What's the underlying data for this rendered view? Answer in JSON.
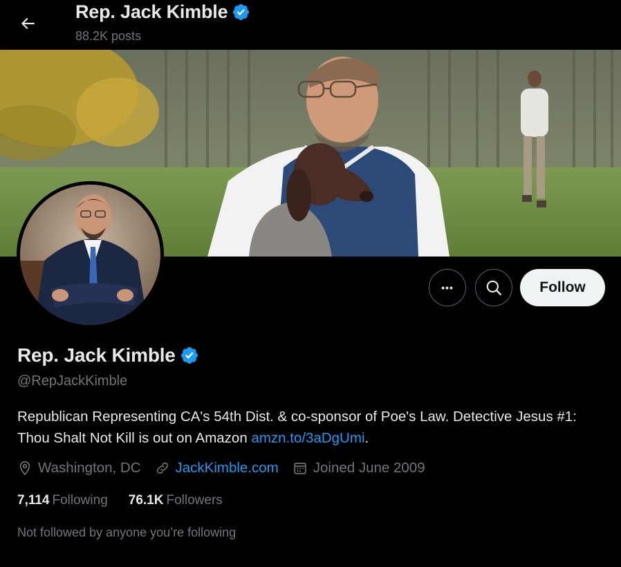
{
  "header": {
    "name": "Rep. Jack Kimble",
    "posts": "88.2K posts"
  },
  "actions": {
    "more_glyph": "•••",
    "follow_label": "Follow"
  },
  "profile": {
    "name": "Rep. Jack Kimble",
    "handle": "@RepJackKimble",
    "bio_text": "Republican Representing CA's 54th Dist. & co-sponsor of Poe's Law. Detective Jesus #1: Thou Shalt Not Kill is out on Amazon ",
    "bio_link": "amzn.to/3aDgUmi",
    "bio_end": ".",
    "location": "Washington, DC",
    "website": "JackKimble.com",
    "joined": "Joined June 2009"
  },
  "stats": {
    "following_count": "7,114",
    "following_label": "Following",
    "followers_count": "76.1K",
    "followers_label": "Followers"
  },
  "note": "Not followed by anyone you’re following",
  "icons": {
    "back": "arrow-left-icon",
    "verified": "verified-badge-icon",
    "more": "more-icon",
    "search": "search-icon",
    "location": "location-pin-icon",
    "link": "link-icon",
    "calendar": "calendar-icon"
  },
  "colors": {
    "background": "#000000",
    "accent": "#1d9bf0",
    "text": "#e7e9ea",
    "muted": "#71767b",
    "follow_bg": "#eff3f4"
  }
}
